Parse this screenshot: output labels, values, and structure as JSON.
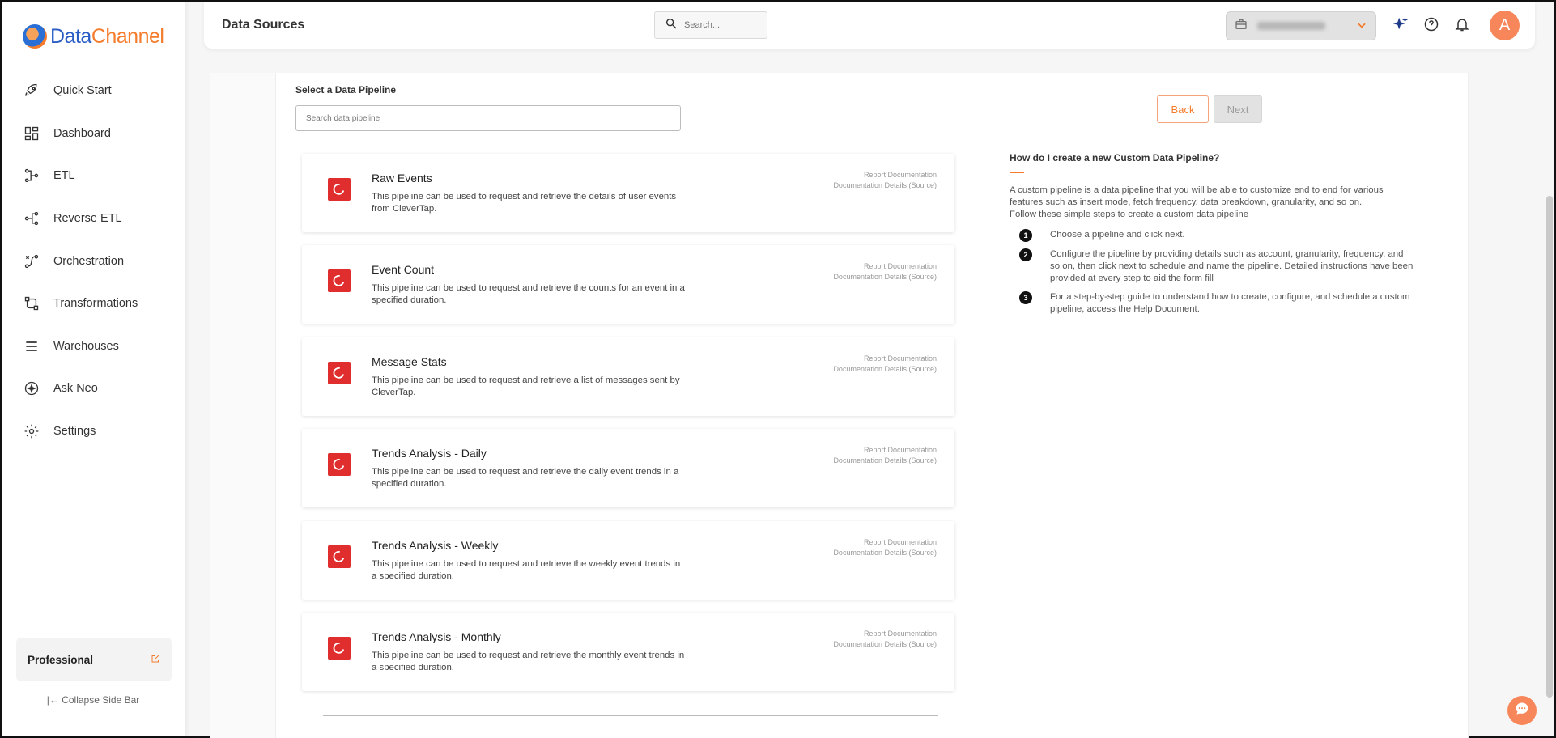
{
  "brand": {
    "data": "Data",
    "channel": "Channel"
  },
  "sidebar": {
    "items": [
      {
        "label": "Quick Start",
        "icon": "rocket-icon"
      },
      {
        "label": "Dashboard",
        "icon": "dashboard-icon"
      },
      {
        "label": "ETL",
        "icon": "etl-icon"
      },
      {
        "label": "Reverse ETL",
        "icon": "reverse-etl-icon"
      },
      {
        "label": "Orchestration",
        "icon": "orchestration-icon"
      },
      {
        "label": "Transformations",
        "icon": "transformations-icon"
      },
      {
        "label": "Warehouses",
        "icon": "warehouses-icon"
      },
      {
        "label": "Ask Neo",
        "icon": "ask-neo-icon"
      },
      {
        "label": "Settings",
        "icon": "gear-icon"
      }
    ],
    "plan": "Professional",
    "collapse": "Collapse Side Bar"
  },
  "header": {
    "title": "Data Sources",
    "search_placeholder": "Search...",
    "avatar": "A"
  },
  "main": {
    "select_label": "Select a Data Pipeline",
    "search_placeholder": "Search data pipeline",
    "back_label": "Back",
    "next_label": "Next",
    "doc_report": "Report Documentation",
    "doc_details": "Documentation Details (Source)",
    "pipelines": [
      {
        "title": "Raw Events",
        "desc": "This pipeline can be used to request and retrieve the details of user events from CleverTap."
      },
      {
        "title": "Event Count",
        "desc": "This pipeline can be used to request and retrieve the counts for an event in a specified duration."
      },
      {
        "title": "Message Stats",
        "desc": "This pipeline can be used to request and retrieve a list of messages sent by CleverTap."
      },
      {
        "title": "Trends Analysis - Daily",
        "desc": "This pipeline can be used to request and retrieve the daily event trends in a specified duration."
      },
      {
        "title": "Trends Analysis - Weekly",
        "desc": "This pipeline can be used to request and retrieve the weekly event trends in a specified duration."
      },
      {
        "title": "Trends Analysis - Monthly",
        "desc": "This pipeline can be used to request and retrieve the monthly event trends in a specified duration."
      }
    ]
  },
  "help": {
    "title": "How do I create a new Custom Data Pipeline?",
    "intro": "A custom pipeline is a data pipeline that you will be able to customize end to end for various features such as insert mode, fetch frequency, data breakdown, granularity, and so on.",
    "follow": "Follow these simple steps to create a custom data pipeline",
    "steps": [
      {
        "num": "1",
        "text": "Choose a pipeline and click next."
      },
      {
        "num": "2",
        "text": "Configure the pipeline by providing details such as account, granularity, frequency, and so on, then click next to schedule and name the pipeline. Detailed instructions have been provided at every step to aid the form fill"
      },
      {
        "num": "3",
        "text": "For a step-by-step guide to understand how to create, configure, and schedule a custom pipeline, access the Help Document."
      }
    ]
  },
  "colors": {
    "accent": "#f47c2c",
    "brand_blue": "#2a5cc4",
    "clevertap_red": "#e02d2d"
  }
}
